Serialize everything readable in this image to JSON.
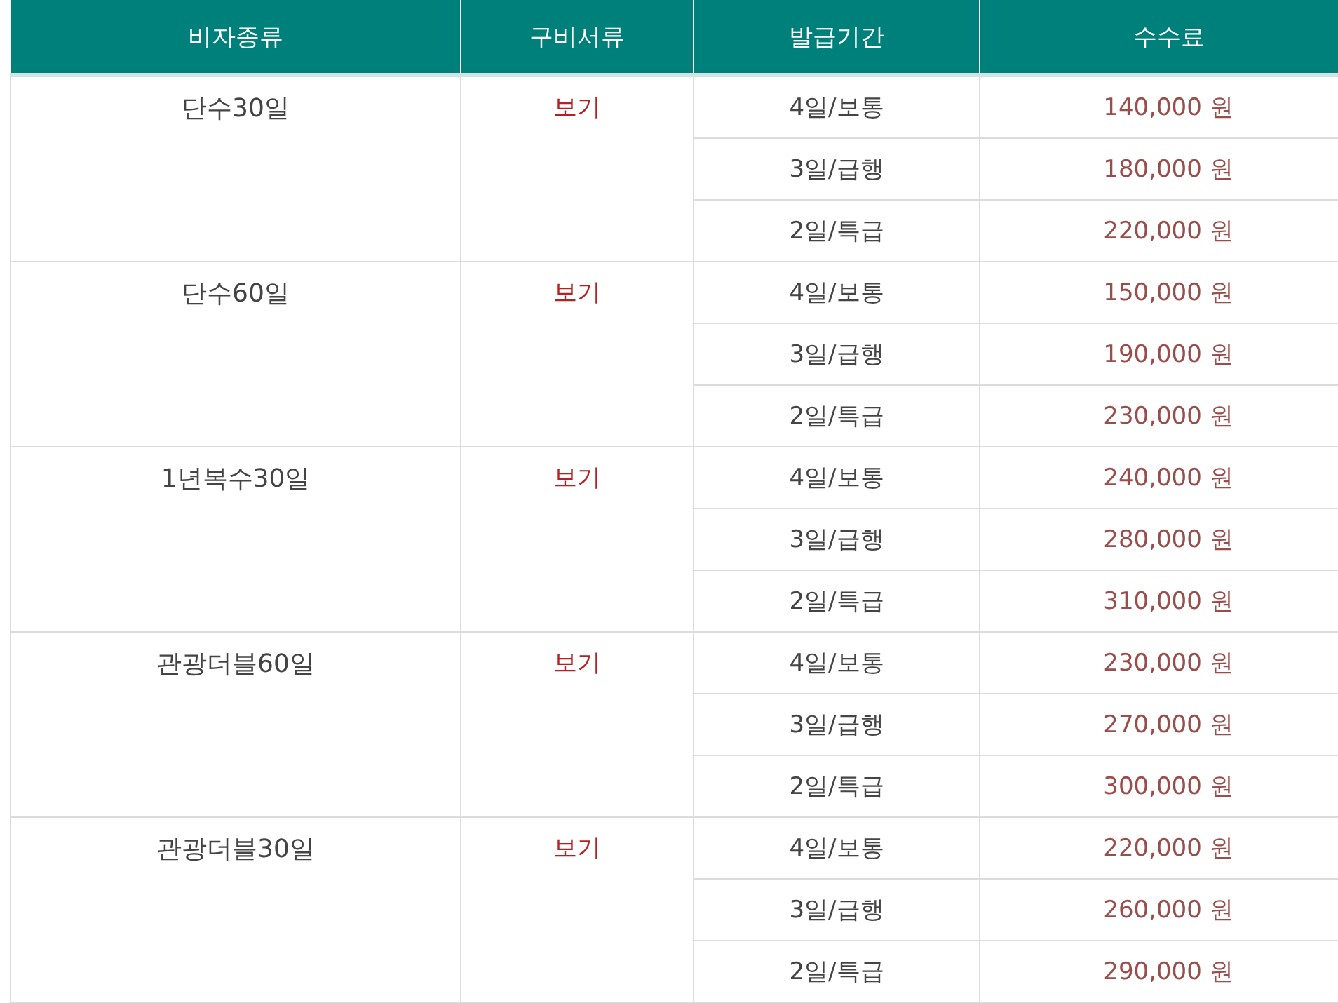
{
  "table": {
    "columns": [
      "비자종류",
      "구비서류",
      "발급기간",
      "수수료"
    ],
    "groups": [
      {
        "visa_type": "단수30일",
        "documents_link": "보기",
        "options": [
          {
            "period": "4일/보통",
            "fee": "140,000 원"
          },
          {
            "period": "3일/급행",
            "fee": "180,000 원"
          },
          {
            "period": "2일/특급",
            "fee": "220,000 원"
          }
        ]
      },
      {
        "visa_type": "단수60일",
        "documents_link": "보기",
        "options": [
          {
            "period": "4일/보통",
            "fee": "150,000 원"
          },
          {
            "period": "3일/급행",
            "fee": "190,000 원"
          },
          {
            "period": "2일/특급",
            "fee": "230,000 원"
          }
        ]
      },
      {
        "visa_type": "1년복수30일",
        "documents_link": "보기",
        "options": [
          {
            "period": "4일/보통",
            "fee": "240,000 원"
          },
          {
            "period": "3일/급행",
            "fee": "280,000 원"
          },
          {
            "period": "2일/특급",
            "fee": "310,000 원"
          }
        ]
      },
      {
        "visa_type": "관광더블60일",
        "documents_link": "보기",
        "options": [
          {
            "period": "4일/보통",
            "fee": "230,000 원"
          },
          {
            "period": "3일/급행",
            "fee": "270,000 원"
          },
          {
            "period": "2일/특급",
            "fee": "300,000 원"
          }
        ]
      },
      {
        "visa_type": "관광더블30일",
        "documents_link": "보기",
        "options": [
          {
            "period": "4일/보통",
            "fee": "220,000 원"
          },
          {
            "period": "3일/급행",
            "fee": "260,000 원"
          },
          {
            "period": "2일/특급",
            "fee": "290,000 원"
          }
        ]
      }
    ]
  }
}
